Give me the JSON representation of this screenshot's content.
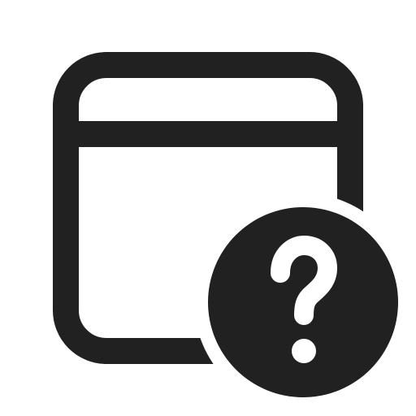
{
  "icon": {
    "name": "window-question-icon",
    "parts": [
      "window-frame",
      "window-title-bar-divider",
      "help-badge",
      "question-mark-glyph"
    ]
  },
  "colors": {
    "foreground": "#212121",
    "background": "#ffffff",
    "badge_glyph": "#ffffff"
  }
}
